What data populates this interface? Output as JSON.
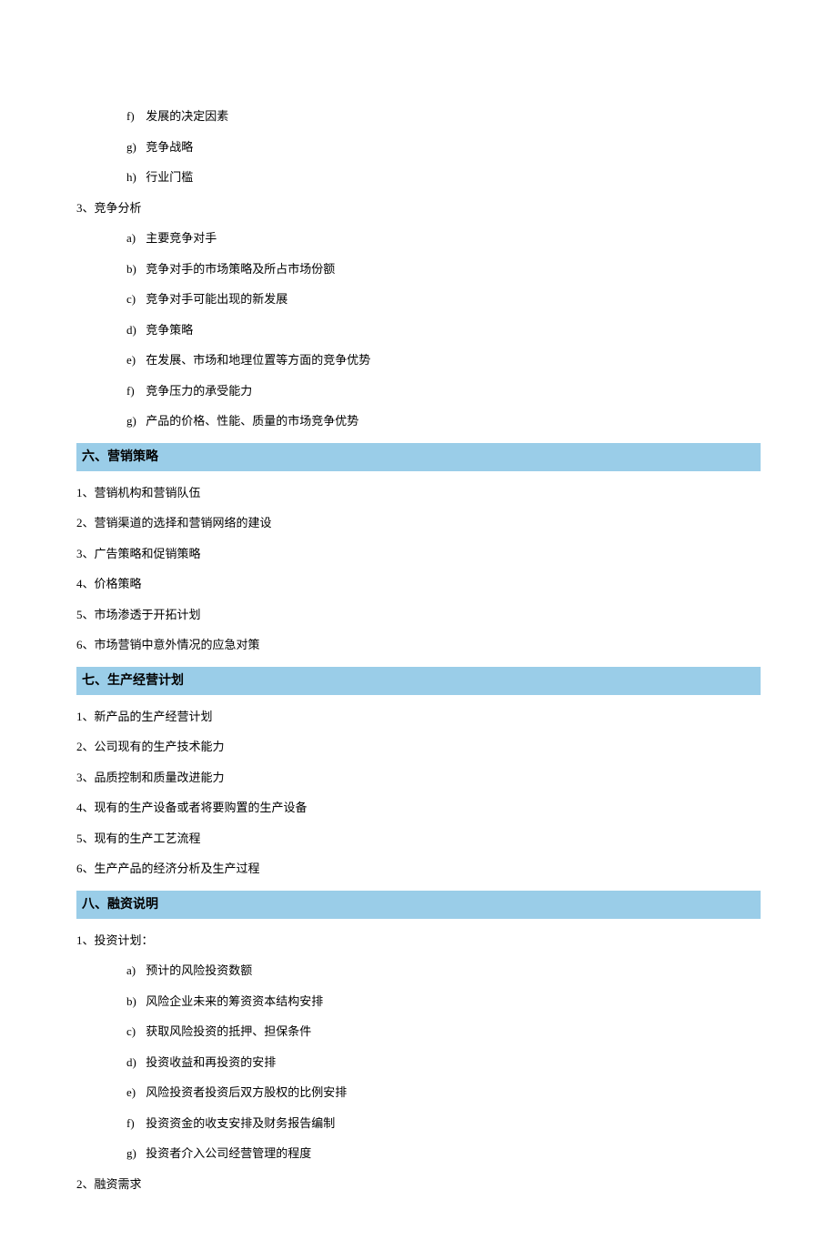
{
  "preSubItems": [
    {
      "marker": "f)",
      "text": "发展的决定因素"
    },
    {
      "marker": "g)",
      "text": "竞争战略"
    },
    {
      "marker": "h)",
      "text": "行业门槛"
    }
  ],
  "competitionHeader": "3、竞争分析",
  "competitionItems": [
    {
      "marker": "a)",
      "text": "主要竞争对手"
    },
    {
      "marker": "b)",
      "text": "竞争对手的市场策略及所占市场份额"
    },
    {
      "marker": "c)",
      "text": "竞争对手可能出现的新发展"
    },
    {
      "marker": "d)",
      "text": "竞争策略"
    },
    {
      "marker": "e)",
      "text": "在发展、市场和地理位置等方面的竞争优势"
    },
    {
      "marker": "f)",
      "text": "竞争压力的承受能力"
    },
    {
      "marker": "g)",
      "text": "产品的价格、性能、质量的市场竞争优势"
    }
  ],
  "section6": {
    "title": "六、营销策略",
    "items": [
      "1、营销机构和营销队伍",
      "2、营销渠道的选择和营销网络的建设",
      "3、广告策略和促销策略",
      "4、价格策略",
      "5、市场渗透于开拓计划",
      "6、市场营销中意外情况的应急对策"
    ]
  },
  "section7": {
    "title": "七、生产经营计划",
    "items": [
      "1、新产品的生产经营计划",
      "2、公司现有的生产技术能力",
      "3、品质控制和质量改进能力",
      "4、现有的生产设备或者将要购置的生产设备",
      "5、现有的生产工艺流程",
      "6、生产产品的经济分析及生产过程"
    ]
  },
  "section8": {
    "title": "八、融资说明",
    "investHeader": "1、投资计划：",
    "investItems": [
      {
        "marker": "a)",
        "text": "预计的风险投资数额"
      },
      {
        "marker": "b)",
        "text": "风险企业未来的筹资资本结构安排"
      },
      {
        "marker": "c)",
        "text": "获取风险投资的抵押、担保条件"
      },
      {
        "marker": "d)",
        "text": "投资收益和再投资的安排"
      },
      {
        "marker": "e)",
        "text": "风险投资者投资后双方股权的比例安排"
      },
      {
        "marker": "f)",
        "text": "投资资金的收支安排及财务报告编制"
      },
      {
        "marker": "g)",
        "text": "投资者介入公司经营管理的程度"
      }
    ],
    "item2": "2、融资需求"
  }
}
